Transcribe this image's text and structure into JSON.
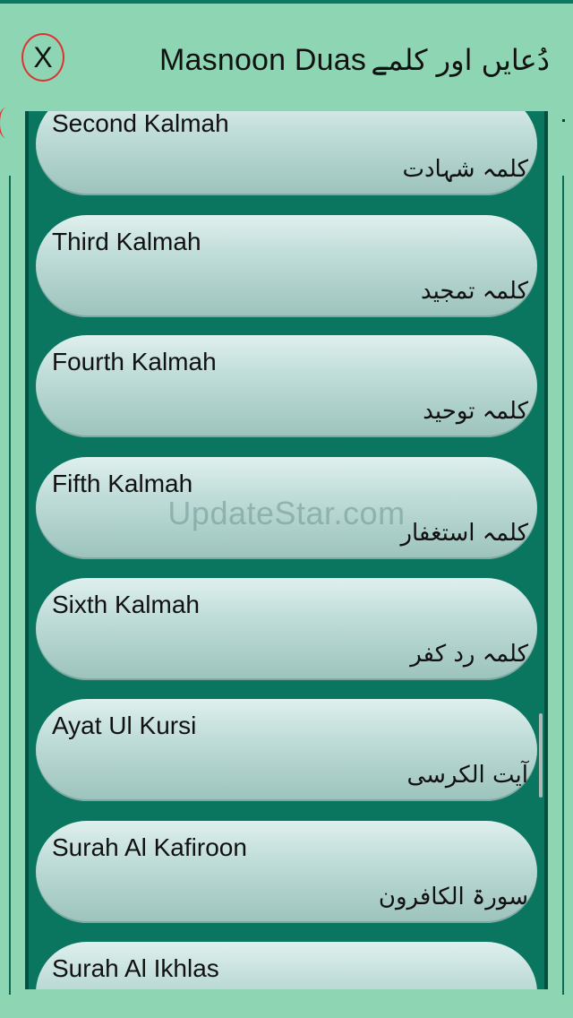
{
  "header": {
    "close_label": "X",
    "title": "Masnoon Duas",
    "urdu_title": "دُعایں اور کلمے"
  },
  "items": [
    {
      "title": "Second Kalmah",
      "urdu": "کلمہ شہادت"
    },
    {
      "title": "Third Kalmah",
      "urdu": "کلمہ تمجید"
    },
    {
      "title": "Fourth Kalmah",
      "urdu": "کلمہ توحید"
    },
    {
      "title": "Fifth Kalmah",
      "urdu": "کلمہ استغفار"
    },
    {
      "title": "Sixth Kalmah",
      "urdu": "کلمہ رد کفر"
    },
    {
      "title": "Ayat Ul Kursi",
      "urdu": "آیت الکرسی"
    },
    {
      "title": "Surah Al Kafiroon",
      "urdu": "سورۃ الکافرون"
    },
    {
      "title": "Surah Al Ikhlas",
      "urdu": ""
    }
  ],
  "watermark": "UpdateStar.com",
  "colors": {
    "background": "#8ed6b3",
    "panel": "#0a7660",
    "close_ring": "#dd3333"
  }
}
